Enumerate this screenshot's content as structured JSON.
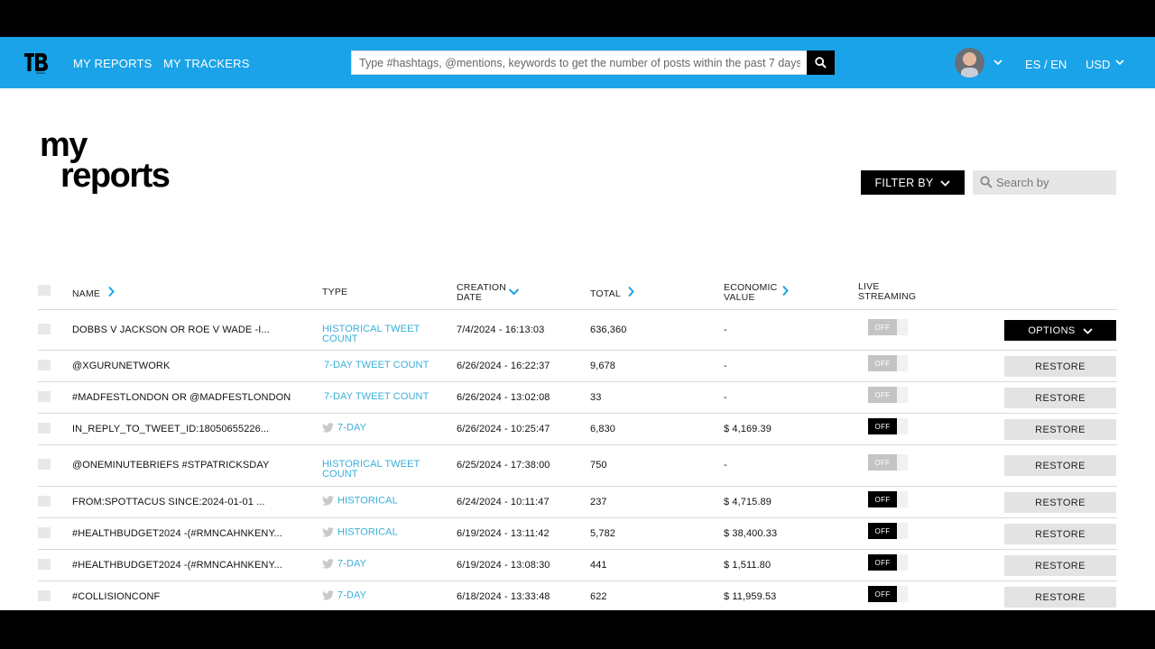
{
  "nav": {
    "my_reports": "MY REPORTS",
    "my_trackers": "MY TRACKERS",
    "search_placeholder": "Type #hashtags, @mentions, keywords to get the number of posts within the past 7 days",
    "lang_es": "ES",
    "lang_sep": " / ",
    "lang_en": "EN",
    "currency": "USD"
  },
  "page": {
    "title_line1": "my",
    "title_line2": "reports",
    "filter_label": "FILTER BY",
    "search_placeholder": "Search by"
  },
  "columns": {
    "name": "NAME",
    "type": "TYPE",
    "creation_date_1": "CREATION",
    "creation_date_2": "DATE",
    "total": "TOTAL",
    "economic_value_1": "ECONOMIC",
    "economic_value_2": "VALUE",
    "live_streaming_1": "LIVE",
    "live_streaming_2": "STREAMING"
  },
  "toggle_label": "OFF",
  "rows": [
    {
      "name": "DOBBS V JACKSON OR ROE V WADE -I...",
      "type1": "HISTORICAL TWEET",
      "type2": "COUNT",
      "date": "7/4/2024 - 16:13:03",
      "total": "636,360",
      "value": "-",
      "action": "OPTIONS"
    },
    {
      "name": "@XGURUNETWORK",
      "type1": "7-DAY TWEET COUNT",
      "type2": "",
      "date": "6/26/2024 - 16:22:37",
      "total": "9,678",
      "value": "-",
      "action": "RESTORE"
    },
    {
      "name": "#MADFESTLONDON OR @MADFESTLONDON",
      "type1": "7-DAY TWEET COUNT",
      "type2": "",
      "date": "6/26/2024 - 13:02:08",
      "total": "33",
      "value": "-",
      "action": "RESTORE"
    },
    {
      "name": "IN_REPLY_TO_TWEET_ID:18050655226...",
      "type1": "7-DAY",
      "type2": "",
      "date": "6/26/2024 - 10:25:47",
      "total": "6,830",
      "value": "$ 4,169.39",
      "action": "RESTORE"
    },
    {
      "name": "@ONEMINUTEBRIEFS #STPATRICKSDAY",
      "type1": "HISTORICAL TWEET",
      "type2": "COUNT",
      "date": "6/25/2024 - 17:38:00",
      "total": "750",
      "value": "-",
      "action": "RESTORE"
    },
    {
      "name": "FROM:SPOTTACUS SINCE:2024-01-01 ...",
      "type1": "HISTORICAL",
      "type2": "",
      "date": "6/24/2024 - 10:11:47",
      "total": "237",
      "value": "$ 4,715.89",
      "action": "RESTORE"
    },
    {
      "name": "#HEALTHBUDGET2024 -(#RMNCAHNKENY...",
      "type1": "HISTORICAL",
      "type2": "",
      "date": "6/19/2024 - 13:11:42",
      "total": "5,782",
      "value": "$ 38,400.33",
      "action": "RESTORE"
    },
    {
      "name": "#HEALTHBUDGET2024 -(#RMNCAHNKENY...",
      "type1": "7-DAY",
      "type2": "",
      "date": "6/19/2024 - 13:08:30",
      "total": "441",
      "value": "$ 1,511.80",
      "action": "RESTORE"
    },
    {
      "name": "#COLLISIONCONF",
      "type1": "7-DAY",
      "type2": "",
      "date": "6/18/2024 - 13:33:48",
      "total": "622",
      "value": "$ 11,959.53",
      "action": "RESTORE"
    }
  ]
}
